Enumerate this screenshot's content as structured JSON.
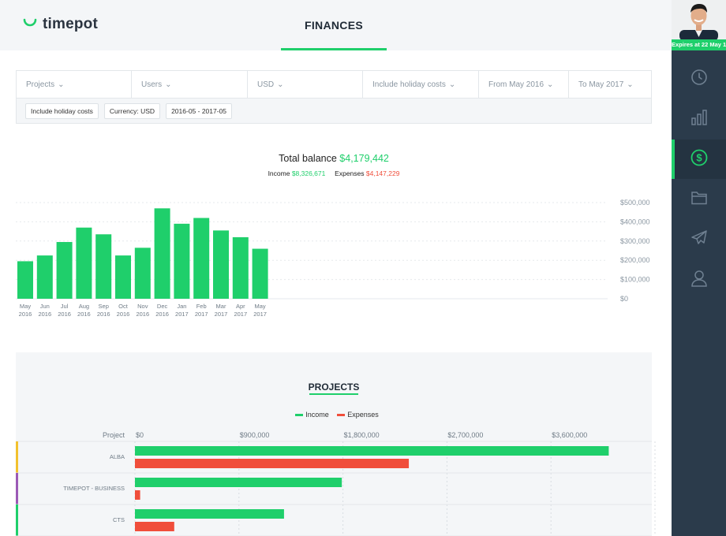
{
  "app": {
    "logo_text": "timepot",
    "page_title": "FINANCES"
  },
  "user": {
    "expires": "Expires at 22 May 18"
  },
  "sidebar": {
    "items": [
      {
        "name": "time-tracking",
        "icon": "clock-icon",
        "active": false
      },
      {
        "name": "reports",
        "icon": "bar-chart-icon",
        "active": false
      },
      {
        "name": "finances",
        "icon": "dollar-icon",
        "active": true
      },
      {
        "name": "projects",
        "icon": "folder-icon",
        "active": false
      },
      {
        "name": "holidays",
        "icon": "plane-icon",
        "active": false
      },
      {
        "name": "users",
        "icon": "user-icon",
        "active": false
      }
    ]
  },
  "filters": {
    "projects": "Projects",
    "users": "Users",
    "currency": "USD",
    "holiday": "Include holiday costs",
    "from": "From May 2016",
    "to": "To May 2017"
  },
  "chips": [
    "Include holiday costs",
    "Currency: USD",
    "2016-05 - 2017-05"
  ],
  "balance": {
    "label": "Total balance",
    "value": "$4,179,442",
    "income_label": "Income",
    "income_value": "$8,326,671",
    "expenses_label": "Expenses",
    "expenses_value": "$4,147,229"
  },
  "projects_section": {
    "title": "PROJECTS",
    "legend_income": "Income",
    "legend_expenses": "Expenses"
  },
  "colors": {
    "accent": "#1fcf6b",
    "expenses": "#f04e3b",
    "sidebar": "#2b3b4b"
  },
  "chart_data": [
    {
      "type": "bar",
      "categories": [
        [
          "May",
          "2016"
        ],
        [
          "Jun",
          "2016"
        ],
        [
          "Jul",
          "2016"
        ],
        [
          "Aug",
          "2016"
        ],
        [
          "Sep",
          "2016"
        ],
        [
          "Oct",
          "2016"
        ],
        [
          "Nov",
          "2016"
        ],
        [
          "Dec",
          "2016"
        ],
        [
          "Jan",
          "2017"
        ],
        [
          "Feb",
          "2017"
        ],
        [
          "Mar",
          "2017"
        ],
        [
          "Apr",
          "2017"
        ],
        [
          "May",
          "2017"
        ]
      ],
      "values": [
        195000,
        225000,
        295000,
        370000,
        335000,
        225000,
        265000,
        470000,
        390000,
        420000,
        355000,
        320000,
        260000
      ],
      "ytick_labels": [
        "$0",
        "$100,000",
        "$200,000",
        "$300,000",
        "$400,000",
        "$500,000"
      ],
      "ylim": [
        0,
        500000
      ],
      "grid": true,
      "color": "#1fcf6b"
    },
    {
      "type": "bar",
      "orientation": "horizontal",
      "ylabel": "Project",
      "categories": [
        "ALBA",
        "TIMEPOT - BUSINESS",
        "CTS"
      ],
      "category_colors": [
        "#f2c12e",
        "#9b59b6",
        "#1fcf6b"
      ],
      "xtick_labels": [
        "$0",
        "$900,000",
        "$1,800,000",
        "$2,700,000",
        "$3,600,000"
      ],
      "xlim": [
        0,
        4500000
      ],
      "series": [
        {
          "name": "Income",
          "color": "#1fcf6b",
          "values": [
            4100000,
            1790000,
            1290000
          ]
        },
        {
          "name": "Expenses",
          "color": "#f04e3b",
          "values": [
            2370000,
            45000,
            340000
          ]
        }
      ]
    }
  ]
}
